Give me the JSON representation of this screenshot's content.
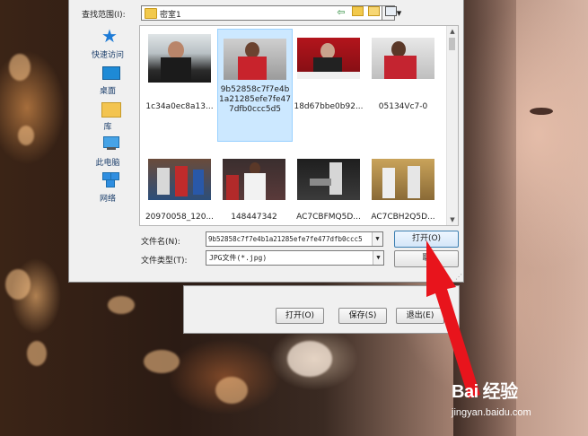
{
  "dialog": {
    "look_in_label": "查找范围(I):",
    "look_in_value": "密室1",
    "toolbar": {
      "back_icon": "back-arrow-icon",
      "up_icon": "folder-up-icon",
      "new_folder_icon": "new-folder-icon",
      "view_icon": "view-menu-icon"
    },
    "places": [
      {
        "label": "快速访问",
        "icon": "star-icon"
      },
      {
        "label": "桌面",
        "icon": "desktop-icon"
      },
      {
        "label": "库",
        "icon": "library-icon"
      },
      {
        "label": "此电脑",
        "icon": "computer-icon"
      },
      {
        "label": "网络",
        "icon": "network-icon"
      }
    ],
    "files": [
      {
        "name": "1c34a0ec8a13...",
        "selected": false
      },
      {
        "name": "9b52858c7f7e4b1a21285efe7fe477dfb0ccc5d5",
        "selected": true
      },
      {
        "name": "18d67bbe0b92...",
        "selected": false
      },
      {
        "name": "05134Vc7-0",
        "selected": false
      },
      {
        "name": "20970058_120...",
        "selected": false
      },
      {
        "name": "148447342",
        "selected": false
      },
      {
        "name": "AC7CBFMQ5D...",
        "selected": false
      },
      {
        "name": "AC7CBH2Q5D...",
        "selected": false
      }
    ],
    "filename_label": "文件名(N):",
    "filename_value": "9b52858c7f7e4b1a21285efe7fe477dfb0ccc5",
    "filetype_label": "文件类型(T):",
    "filetype_value": "JPG文件(*.jpg)",
    "open_button": "打开(O)",
    "cancel_button": "取"
  },
  "back_dialog": {
    "buttons": [
      "打开(O)",
      "保存(S)",
      "退出(E)"
    ]
  },
  "annotation": {
    "arrow_color": "#e8141c"
  },
  "watermark": {
    "logo": "Bai 经验",
    "url": "jingyan.baidu.com"
  }
}
